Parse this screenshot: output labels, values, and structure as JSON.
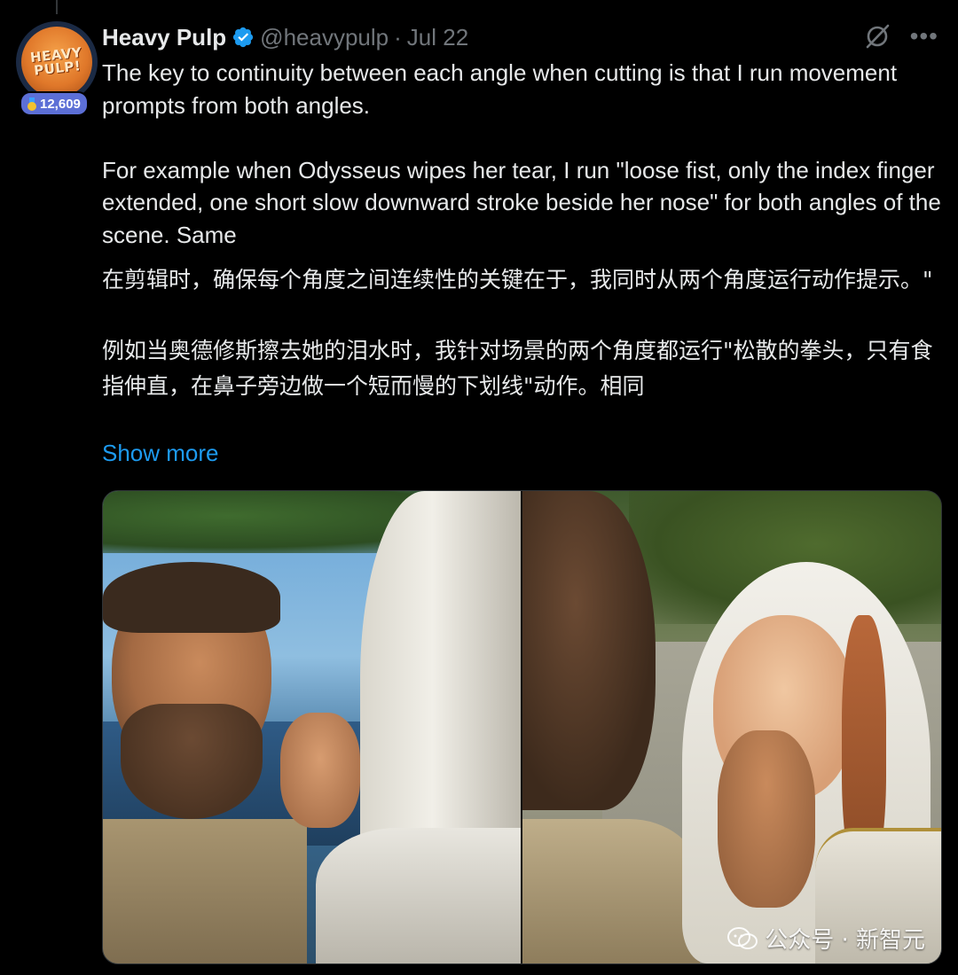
{
  "tweet": {
    "author": {
      "display_name": "Heavy Pulp",
      "handle": "@heavypulp",
      "separator": "·",
      "date": "Jul 22",
      "avatar_text": "HEAVY PULP!",
      "badge_count": "12,609",
      "verified_color": "#1d9bf0"
    },
    "text_en": "The key to continuity between each angle when cutting is that I run movement prompts from both angles.\n\nFor example when Odysseus wipes her tear, I run \"loose fist, only the index finger extended, one short slow downward stroke beside her nose\" for both angles of the scene. Same",
    "text_zh": "在剪辑时，确保每个角度之间连续性的关键在于，我同时从两个角度运行动作提示。\"\n\n例如当奥德修斯擦去她的泪水时，我针对场景的两个角度都运行\"松散的拳头，只有食指伸直，在鼻子旁边做一个短而慢的下划线\"动作。相同",
    "show_more_label": "Show more",
    "link_color": "#1d9bf0"
  },
  "media": {
    "watermark_text": "公众号 · 新智元"
  },
  "icons": {
    "grok": "grok-icon",
    "more": "more-icon",
    "verified": "verified-badge-icon",
    "medal": "medal-icon",
    "wechat": "wechat-icon"
  }
}
